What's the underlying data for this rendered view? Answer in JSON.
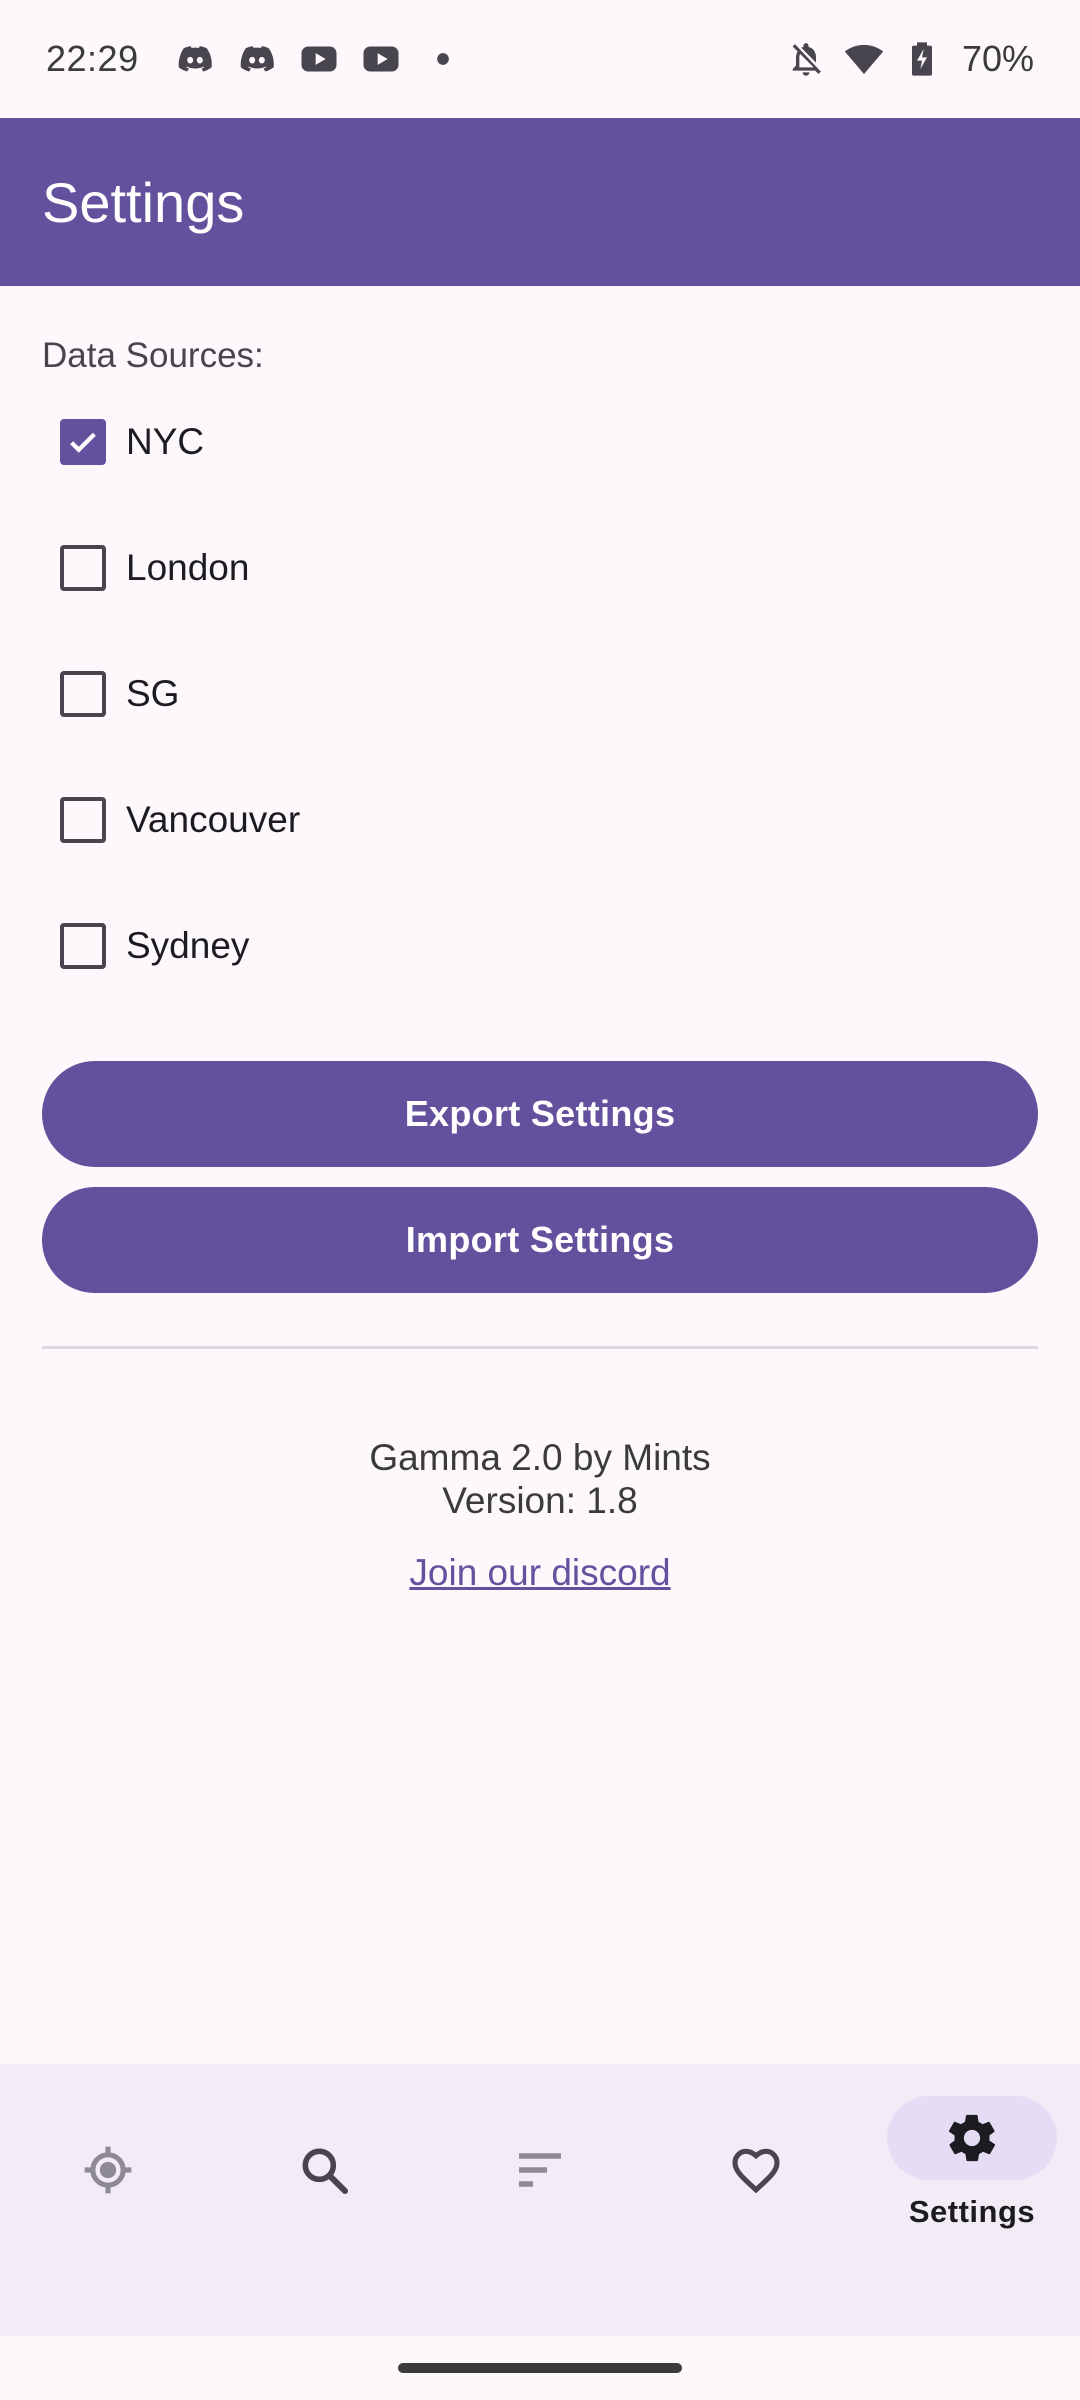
{
  "status_bar": {
    "time": "22:29",
    "left_icons": [
      "discord-icon",
      "discord-icon",
      "youtube-icon",
      "youtube-icon",
      "dot-icon"
    ],
    "right_icons": [
      "bell-off-icon",
      "wifi-icon",
      "battery-charging-icon"
    ],
    "battery": "70%"
  },
  "app_bar": {
    "title": "Settings"
  },
  "data_sources": {
    "label": "Data Sources:",
    "items": [
      {
        "label": "NYC",
        "checked": true
      },
      {
        "label": "London",
        "checked": false
      },
      {
        "label": "SG",
        "checked": false
      },
      {
        "label": "Vancouver",
        "checked": false
      },
      {
        "label": "Sydney",
        "checked": false
      }
    ]
  },
  "buttons": {
    "export": "Export Settings",
    "import": "Import Settings"
  },
  "about": {
    "app_name": "Gamma 2.0 by Mints",
    "version": "Version: 1.8",
    "discord_link": "Join our discord"
  },
  "bottom_nav": {
    "items": [
      {
        "icon": "crosshair-icon",
        "label": "",
        "active": false
      },
      {
        "icon": "search-icon",
        "label": "",
        "active": false
      },
      {
        "icon": "sort-icon",
        "label": "",
        "active": false
      },
      {
        "icon": "heart-icon",
        "label": "",
        "active": false
      },
      {
        "icon": "gear-icon",
        "label": "Settings",
        "active": true
      }
    ]
  },
  "colors": {
    "primary": "#63519e",
    "background": "#fcf8fc",
    "nav_background": "#f2ecf6",
    "nav_active_indicator": "#e5dcf6"
  }
}
